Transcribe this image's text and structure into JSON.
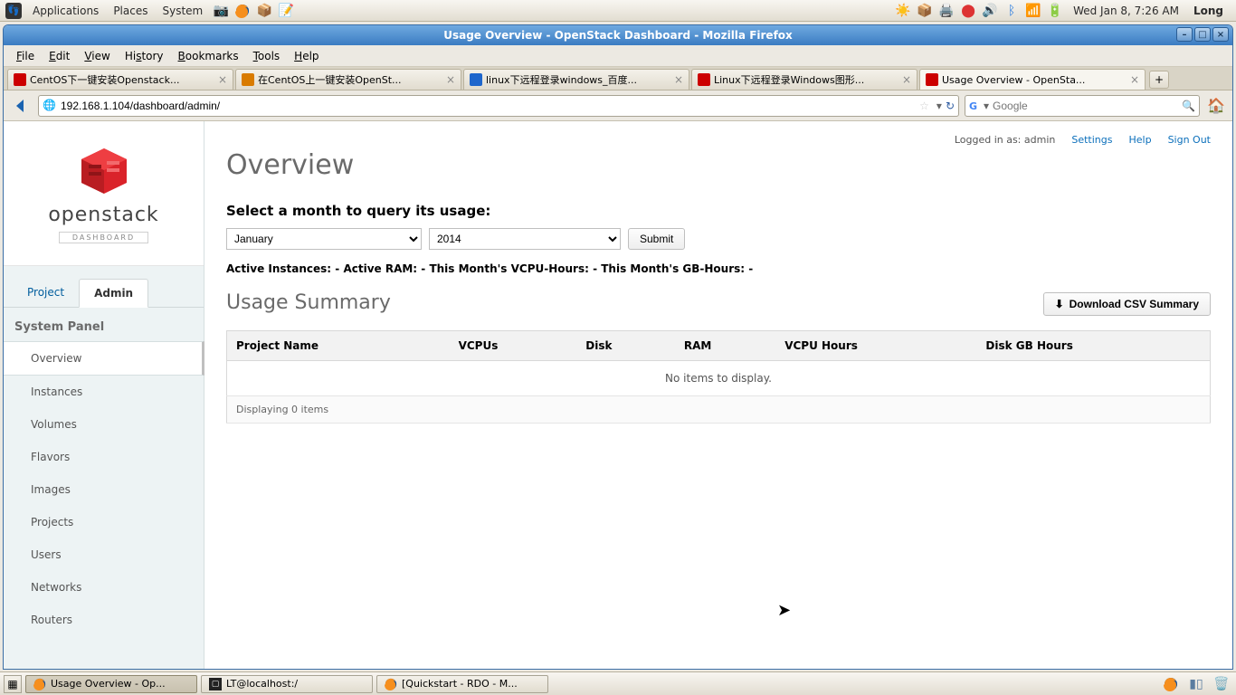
{
  "gnome": {
    "menus": [
      "Applications",
      "Places",
      "System"
    ],
    "clock": "Wed Jan  8,  7:26 AM",
    "user": "Long"
  },
  "window": {
    "title": "Usage Overview - OpenStack Dashboard - Mozilla Firefox"
  },
  "firefox": {
    "menus": [
      "File",
      "Edit",
      "View",
      "History",
      "Bookmarks",
      "Tools",
      "Help"
    ],
    "tabs": [
      {
        "label": "CentOS下一键安装Openstack..."
      },
      {
        "label": "在CentOS上一键安装OpenSt..."
      },
      {
        "label": "linux下远程登录windows_百度..."
      },
      {
        "label": "Linux下远程登录Windows图形..."
      },
      {
        "label": "Usage Overview - OpenSta...",
        "active": true
      }
    ],
    "url": "192.168.1.104/dashboard/admin/",
    "search_placeholder": "Google"
  },
  "openstack": {
    "brand": "openstack",
    "brand_sub": "DASHBOARD",
    "nav_tabs": [
      {
        "label": "Project"
      },
      {
        "label": "Admin",
        "active": true
      }
    ],
    "panel_header": "System Panel",
    "side_items": [
      {
        "label": "Overview",
        "active": true
      },
      {
        "label": "Instances"
      },
      {
        "label": "Volumes"
      },
      {
        "label": "Flavors"
      },
      {
        "label": "Images"
      },
      {
        "label": "Projects"
      },
      {
        "label": "Users"
      },
      {
        "label": "Networks"
      },
      {
        "label": "Routers"
      }
    ],
    "logged_in_prefix": "Logged in as: ",
    "logged_in_user": "admin",
    "top_links": [
      "Settings",
      "Help",
      "Sign Out"
    ],
    "page_title": "Overview",
    "select_prompt": "Select a month to query its usage:",
    "month_value": "January",
    "year_value": "2014",
    "submit_label": "Submit",
    "stats_line": "Active Instances: - Active RAM: - This Month's VCPU-Hours: - This Month's GB-Hours: -",
    "summary_title": "Usage Summary",
    "download_label": "Download CSV Summary",
    "columns": [
      "Project Name",
      "VCPUs",
      "Disk",
      "RAM",
      "VCPU Hours",
      "Disk GB Hours"
    ],
    "empty_msg": "No items to display.",
    "footer_msg": "Displaying 0 items"
  },
  "taskbar": [
    {
      "label": "Usage Overview - Op...",
      "icon": "ff",
      "active": true
    },
    {
      "label": "LT@localhost:/",
      "icon": "term"
    },
    {
      "label": "[Quickstart - RDO - M...",
      "icon": "ff"
    }
  ]
}
